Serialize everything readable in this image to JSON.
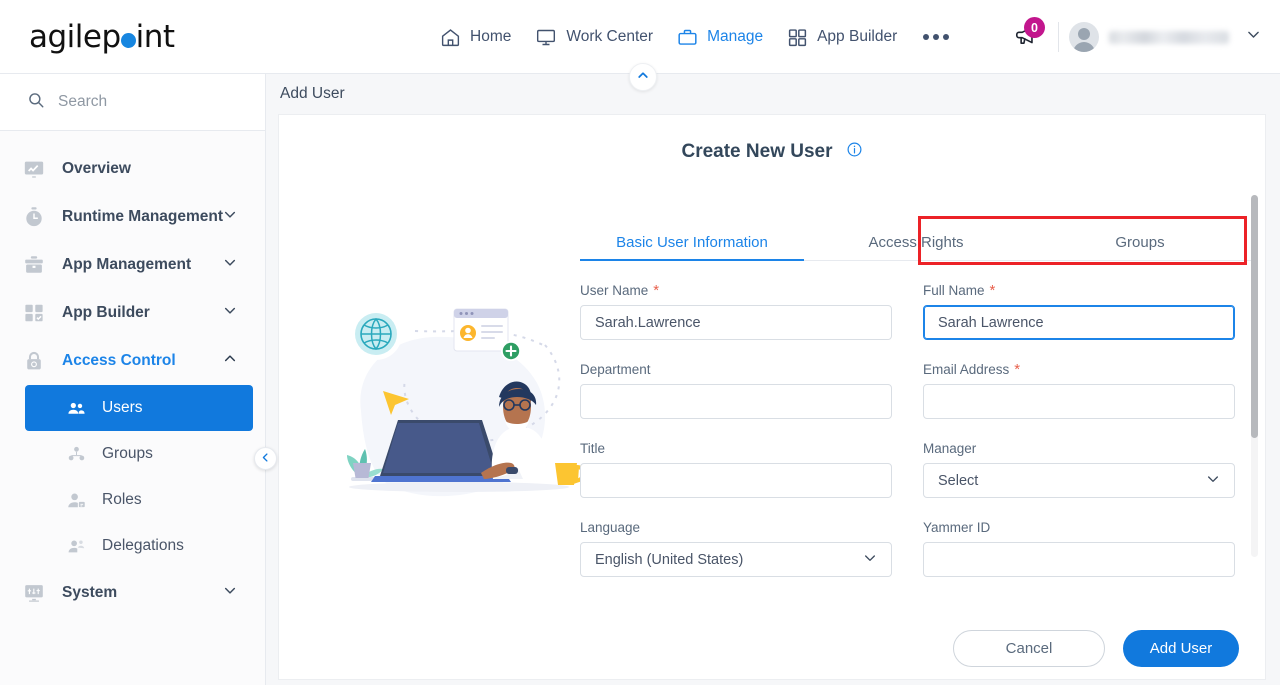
{
  "brand": {
    "name_a": "agilep",
    "name_b": "int"
  },
  "topnav": {
    "items": [
      {
        "label": "Home",
        "icon": "home-icon",
        "active": false
      },
      {
        "label": "Work Center",
        "icon": "monitor-icon",
        "active": false
      },
      {
        "label": "Manage",
        "icon": "briefcase-icon",
        "active": true
      },
      {
        "label": "App Builder",
        "icon": "grid-icon",
        "active": false
      }
    ],
    "more_label": "",
    "announcement_count": "0",
    "user_name": "",
    "caret": "chevron-down-icon"
  },
  "sidebar": {
    "search_placeholder": "Search",
    "items": [
      {
        "label": "Overview",
        "icon": "chart-monitor-icon",
        "expandable": false,
        "active": false
      },
      {
        "label": "Runtime Management",
        "icon": "stopwatch-icon",
        "expandable": true,
        "active": false
      },
      {
        "label": "App Management",
        "icon": "toolbox-icon",
        "expandable": true,
        "active": false
      },
      {
        "label": "App Builder",
        "icon": "grid-check-icon",
        "expandable": true,
        "active": false
      },
      {
        "label": "Access Control",
        "icon": "lock-icon",
        "expandable": true,
        "active": true
      }
    ],
    "subitems": [
      {
        "label": "Users",
        "icon": "users-icon",
        "selected": true
      },
      {
        "label": "Groups",
        "icon": "group-icon",
        "selected": false
      },
      {
        "label": "Roles",
        "icon": "role-user-icon",
        "selected": false
      },
      {
        "label": "Delegations",
        "icon": "delegate-user-icon",
        "selected": false
      }
    ],
    "footer_items": [
      {
        "label": "System",
        "icon": "system-monitor-icon",
        "expandable": true
      }
    ]
  },
  "content": {
    "breadcrumb": "Add User",
    "card_title": "Create New User",
    "info_icon": "info-icon",
    "tabs": [
      {
        "label": "Basic User Information",
        "active": true
      },
      {
        "label": "Access Rights",
        "active": false
      },
      {
        "label": "Groups",
        "active": false
      }
    ],
    "fields": {
      "user_name": {
        "label": "User Name",
        "required": true,
        "value": "Sarah.Lawrence"
      },
      "full_name": {
        "label": "Full Name",
        "required": true,
        "value": "Sarah Lawrence",
        "focused": true,
        "highlighted": true
      },
      "department": {
        "label": "Department",
        "required": false,
        "value": ""
      },
      "email_address": {
        "label": "Email Address",
        "required": true,
        "value": ""
      },
      "title": {
        "label": "Title",
        "required": false,
        "value": ""
      },
      "manager": {
        "label": "Manager",
        "required": false,
        "value": "Select",
        "type": "select"
      },
      "language": {
        "label": "Language",
        "required": false,
        "value": "English (United States)",
        "type": "select"
      },
      "yammer_id": {
        "label": "Yammer ID",
        "required": false,
        "value": ""
      }
    },
    "buttons": {
      "cancel": "Cancel",
      "submit": "Add User"
    }
  },
  "colors": {
    "accent_blue": "#1179dd",
    "link_blue": "#1c84e8",
    "badge_magenta": "#c2168d",
    "required_red": "#e8604c",
    "annotation_red": "#ec2227"
  }
}
